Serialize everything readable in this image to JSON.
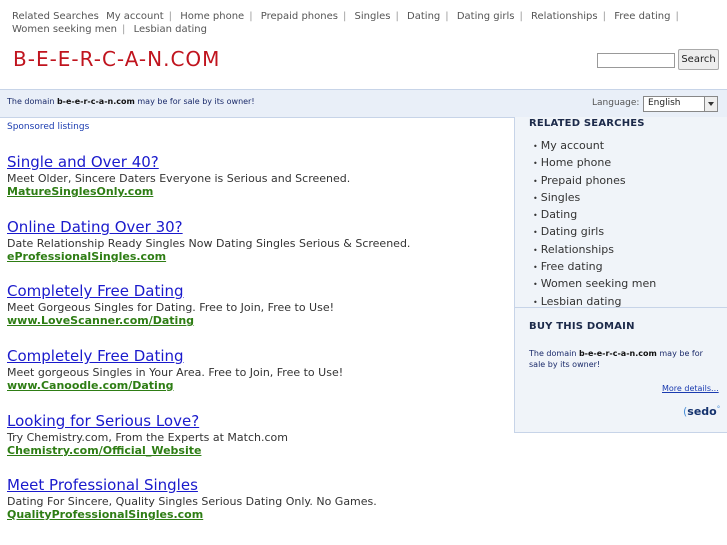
{
  "top_nav": {
    "label": "Related Searches",
    "items": [
      "My account",
      "Home phone",
      "Prepaid phones",
      "Singles",
      "Dating",
      "Dating girls",
      "Relationships",
      "Free dating",
      "Women seeking men",
      "Lesbian dating"
    ]
  },
  "header": {
    "logo": "B-E-E-R-C-A-N.COM",
    "search_value": "",
    "search_button": "Search"
  },
  "info_bar": {
    "sale_prefix": "The domain ",
    "domain": "b-e-e-r-c-a-n.com",
    "sale_suffix": " may be for sale by its owner!",
    "language_label": "Language:",
    "language_value": "English"
  },
  "main": {
    "sponsored_label": "Sponsored listings",
    "ads": [
      {
        "title": "Single and Over 40?",
        "desc": "Meet Older, Sincere Daters Everyone is Serious and Screened.",
        "url": "MatureSinglesOnly.com"
      },
      {
        "title": "Online Dating Over 30?",
        "desc": "Date Relationship Ready Singles Now Dating Singles Serious & Screened.",
        "url": "eProfessionalSingles.com"
      },
      {
        "title": "Completely Free Dating",
        "desc": "Meet Gorgeous Singles for Dating. Free to Join, Free to Use!",
        "url": "www.LoveScanner.com/Dating"
      },
      {
        "title": "Completely Free Dating",
        "desc": "Meet gorgeous Singles in Your Area. Free to Join, Free to Use!",
        "url": "www.Canoodle.com/Dating"
      },
      {
        "title": "Looking for Serious Love?",
        "desc": "Try Chemistry.com, From the Experts at Match.com",
        "url": "Chemistry.com/Official_Website"
      },
      {
        "title": "Meet Professional Singles",
        "desc": "Dating For Sincere, Quality Singles Serious Dating Only. No Games.",
        "url": "QualityProfessionalSingles.com"
      }
    ]
  },
  "sidebar": {
    "related_heading": "RELATED SEARCHES",
    "related_items": [
      "My account",
      "Home phone",
      "Prepaid phones",
      "Singles",
      "Dating",
      "Dating girls",
      "Relationships",
      "Free dating",
      "Women seeking men",
      "Lesbian dating"
    ],
    "buy_heading": "BUY THIS DOMAIN",
    "buy_prefix": "The domain ",
    "buy_domain": "b-e-e-r-c-a-n.com",
    "buy_suffix": " may be for sale by its owner!",
    "more_link": "More details...",
    "sedo_brand": "sedo"
  },
  "colors": {
    "logo": "#c0141e",
    "ad_title": "#1a1acc",
    "ad_url": "#2e7d14",
    "panel_bg": "#f0f4f9"
  }
}
